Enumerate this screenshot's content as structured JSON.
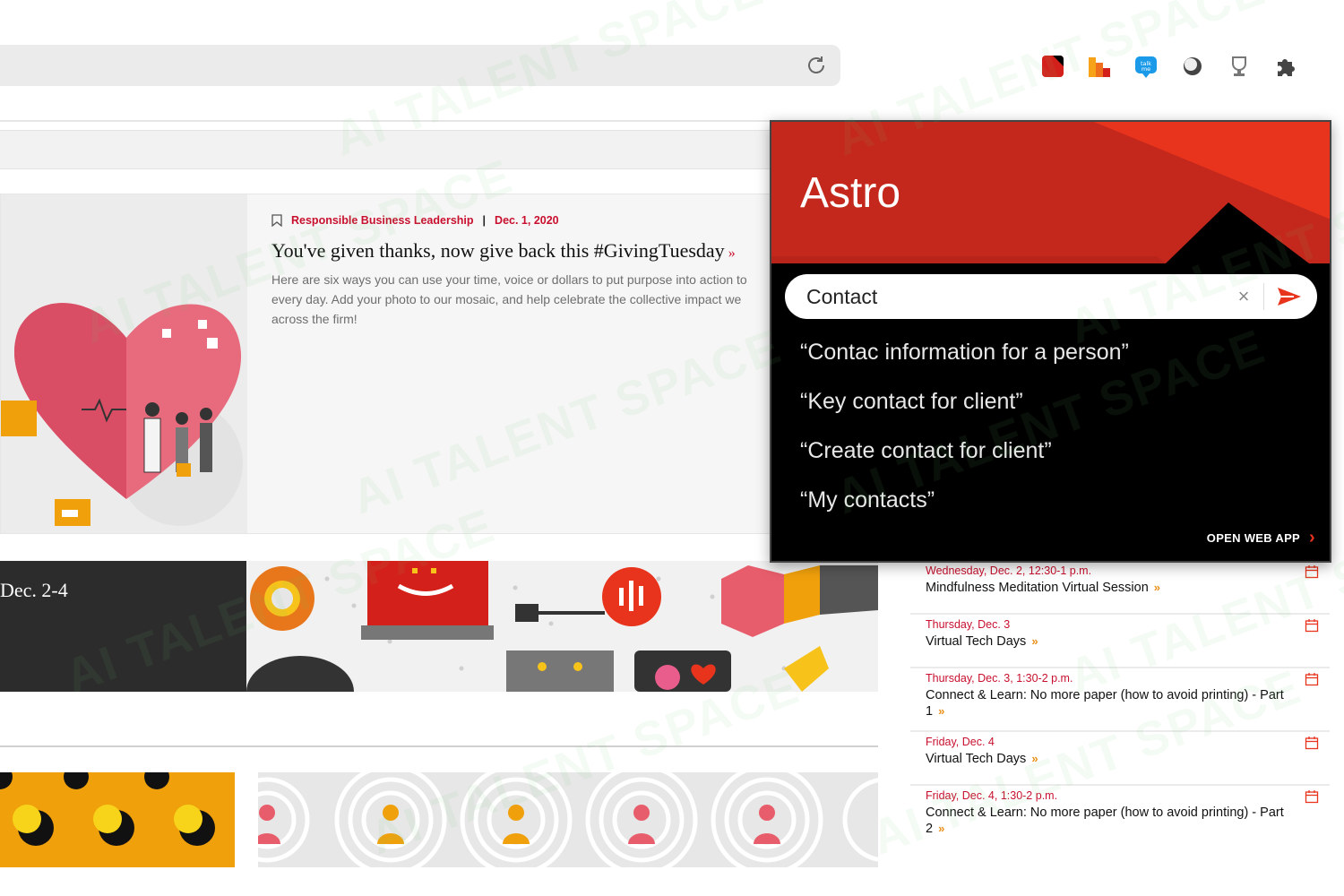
{
  "extensions": [
    {
      "name": "red-square-extension",
      "icon": "red-square-icon",
      "color": "#d4201a"
    },
    {
      "name": "bar-chart-extension",
      "icon": "orange-bars-icon",
      "color": "#e85d1a"
    },
    {
      "name": "talk-extension",
      "icon": "chat-bubble-icon",
      "color": "#1a9ae8",
      "label": "talk me"
    },
    {
      "name": "circle-extension",
      "icon": "grey-circle-icon",
      "color": "#555555"
    },
    {
      "name": "trophy-extension",
      "icon": "trophy-icon",
      "color": "#888888"
    },
    {
      "name": "extensions-menu",
      "icon": "puzzle-icon",
      "color": "#444444"
    }
  ],
  "article": {
    "category": "Responsible Business Leadership",
    "date": "Dec. 1, 2020",
    "title": "You've given thanks, now give back this #GivingTuesday",
    "more": "»",
    "description": "Here are six ways you can use your time, voice or dollars to put purpose into action to every day. Add your photo to our mosaic, and help celebrate the collective impact we across the firm!"
  },
  "banner": {
    "date_range": "Dec. 2-4"
  },
  "events": [
    {
      "when": "Wednesday, Dec. 2, 12:30-1 p.m.",
      "what": "Mindfulness Meditation Virtual Session",
      "chevron": "»"
    },
    {
      "when": "Thursday, Dec. 3",
      "what": "Virtual Tech Days",
      "chevron": "»"
    },
    {
      "when": "Thursday, Dec. 3, 1:30-2 p.m.",
      "what": "Connect & Learn: No more paper (how to avoid printing) - Part 1",
      "chevron": "»"
    },
    {
      "when": "Friday, Dec. 4",
      "what": "Virtual Tech Days",
      "chevron": "»"
    },
    {
      "when": "Friday, Dec. 4, 1:30-2 p.m.",
      "what": "Connect & Learn: No more paper (how to avoid printing) - Part 2",
      "chevron": "»"
    }
  ],
  "astro": {
    "title": "Astro",
    "search_value": "Contact",
    "clear_icon": "×",
    "suggestions": [
      "“Contac information for a person”",
      "“Key contact for client”",
      "“Create contact for client”",
      "“My contacts”"
    ],
    "open_web_app": "OPEN WEB APP",
    "open_web_arrow": "›",
    "colors": {
      "header_red": "#d42a1d",
      "header_light": "#e8341c",
      "accent": "#e8341c"
    }
  },
  "watermark": "AI TALENT SPACE"
}
